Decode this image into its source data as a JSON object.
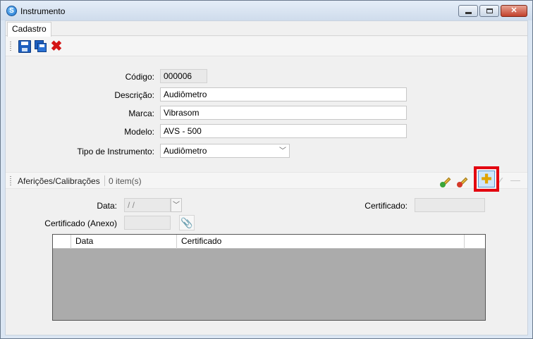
{
  "window": {
    "title": "Instrumento",
    "buttons": {
      "minimize": "–",
      "maximize": "□",
      "close": "✕"
    }
  },
  "tabs": [
    {
      "label": "Cadastro"
    }
  ],
  "toolbar": {
    "items": [
      "save-icon",
      "save-all-icon",
      "delete-icon"
    ]
  },
  "form": {
    "codigo": {
      "label": "Código:",
      "value": "000006"
    },
    "descricao": {
      "label": "Descrição:",
      "value": "Audiômetro"
    },
    "marca": {
      "label": "Marca:",
      "value": "Vibrasom"
    },
    "modelo": {
      "label": "Modelo:",
      "value": "AVS - 500"
    },
    "tipo": {
      "label": "Tipo de Instrumento:",
      "value": "Audiômetro"
    }
  },
  "afericoes": {
    "title": "Aferições/Calibrações",
    "count": "0 item(s)",
    "data_label": "Data:",
    "data_value": " /  /",
    "certificado_label": "Certificado:",
    "certificado_value": "",
    "anexo_label": "Certificado (Anexo)",
    "anexo_value": "",
    "grid": {
      "columns": [
        "",
        "Data",
        "Certificado",
        ""
      ]
    }
  },
  "colors": {
    "highlight": "#e3000f",
    "grid_empty": "#ababab"
  }
}
